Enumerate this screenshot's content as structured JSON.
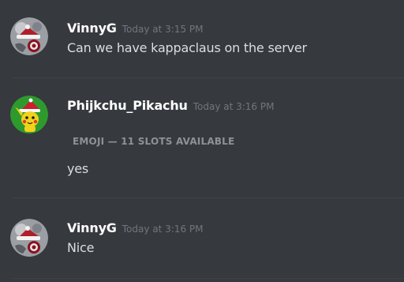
{
  "messages": [
    {
      "username": "VinnyG",
      "timestamp": "Today at 3:15 PM",
      "text": "Can we have kappaclaus on the server",
      "avatar_icon": "santa-hat-avatar-icon"
    },
    {
      "username": "Phijkchu_Pikachu",
      "timestamp": "Today at 3:16 PM",
      "embed_header": "EMOJI — 11 SLOTS AVAILABLE",
      "text": "yes",
      "avatar_icon": "pikachu-santa-avatar-icon"
    },
    {
      "username": "VinnyG",
      "timestamp": "Today at 3:16 PM",
      "text": "Nice",
      "avatar_icon": "santa-hat-avatar-icon"
    }
  ],
  "colors": {
    "background": "#36393e",
    "username": "#ffffff",
    "text": "#dcddde",
    "timestamp": "#72767d",
    "divider": "#3f4247"
  }
}
